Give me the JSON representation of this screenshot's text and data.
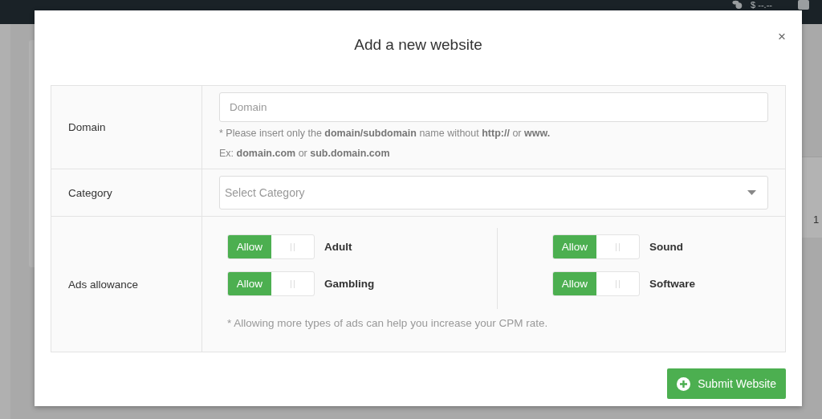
{
  "top_bar": {
    "balance": "$ --.--"
  },
  "background_table": {
    "cell": "1"
  },
  "modal": {
    "title": "Add a new website",
    "close": "×",
    "rows": [
      {
        "kind": "text",
        "label": "Domain",
        "placeholder": "Domain",
        "notes": [
          "* Please insert only the **domain/subdomain** name without **http://** or **www.**",
          "Ex: **domain.com** or **sub.domain.com**"
        ]
      },
      {
        "kind": "select",
        "label": "Category",
        "placeholder": "Select Category"
      },
      {
        "kind": "toggles",
        "label": "Ads allowance",
        "toggles": [
          {
            "label": "Adult",
            "state_text": "Allow",
            "on": true
          },
          {
            "label": "Sound",
            "state_text": "Allow",
            "on": true
          },
          {
            "label": "Gambling",
            "state_text": "Allow",
            "on": true
          },
          {
            "label": "Software",
            "state_text": "Allow",
            "on": true
          }
        ],
        "note": "* Allowing more types of ads can help you increase your CPM rate."
      }
    ],
    "submit": "Submit Website"
  }
}
